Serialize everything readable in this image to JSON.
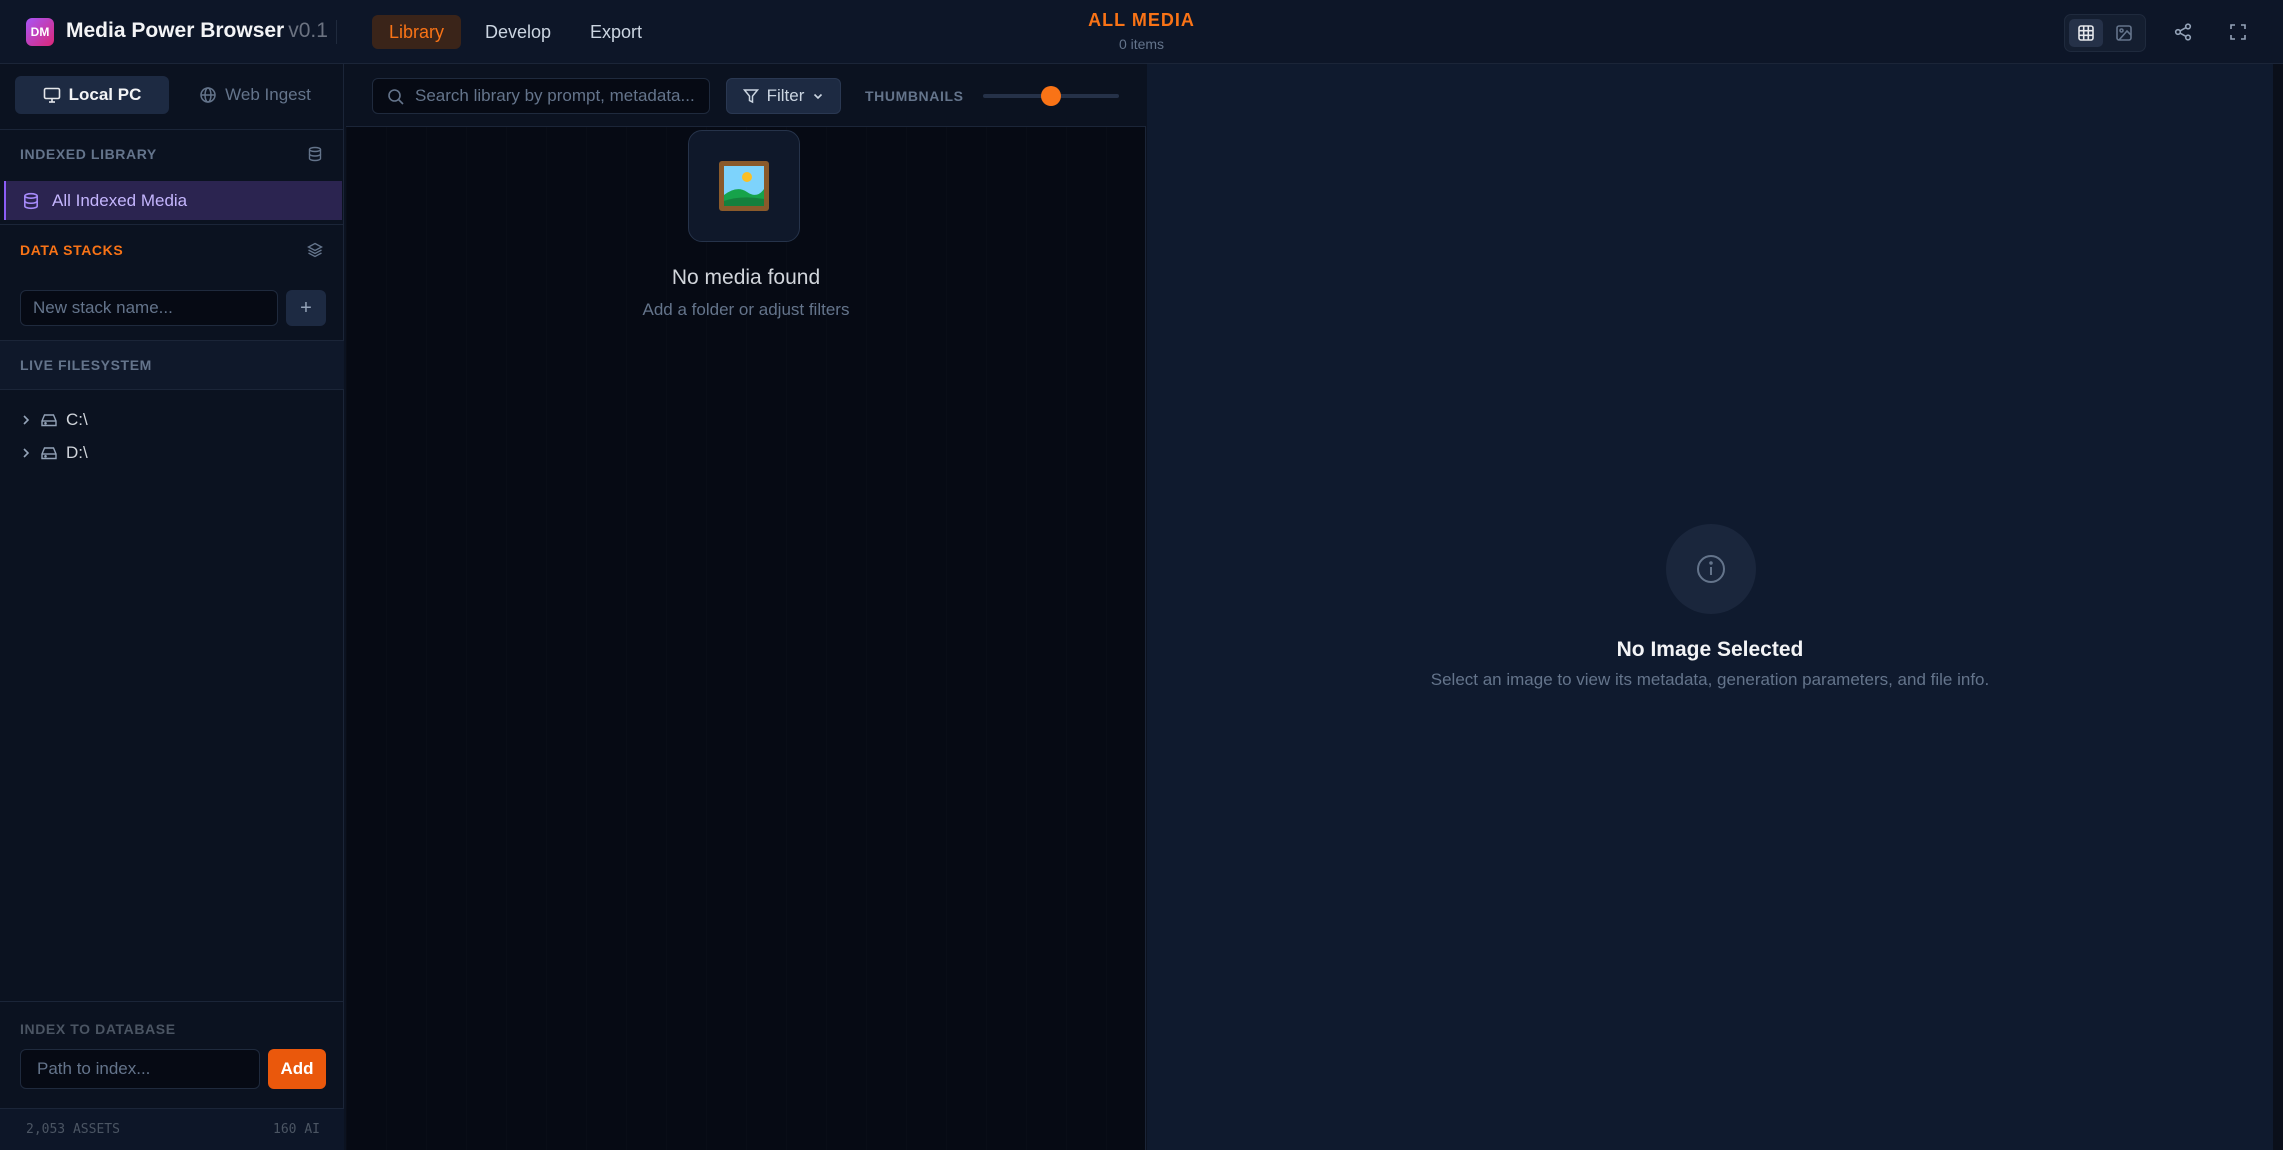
{
  "app": {
    "logo_text": "DM",
    "title": "Media Power Browser",
    "version": "v0.1"
  },
  "nav": {
    "tabs": [
      {
        "label": "Library",
        "active": true
      },
      {
        "label": "Develop",
        "active": false
      },
      {
        "label": "Export",
        "active": false
      }
    ]
  },
  "header": {
    "title": "ALL MEDIA",
    "subtitle": "0 items"
  },
  "view_toggle": {
    "options": [
      "grid-icon",
      "image-icon"
    ],
    "active": "grid-icon"
  },
  "top_actions": [
    "share-icon",
    "fullscreen-icon"
  ],
  "sidebar": {
    "source_tabs": [
      {
        "label": "Local PC",
        "icon": "monitor-icon",
        "active": true
      },
      {
        "label": "Web Ingest",
        "icon": "globe-icon",
        "active": false
      }
    ],
    "indexed_library": {
      "heading": "INDEXED LIBRARY",
      "items": [
        {
          "label": "All Indexed Media",
          "icon": "database-icon",
          "selected": true
        }
      ]
    },
    "data_stacks": {
      "heading": "DATA STACKS",
      "input_placeholder": "New stack name...",
      "add_label": "+"
    },
    "live_filesystem": {
      "heading": "LIVE FILESYSTEM",
      "drives": [
        {
          "label": "C:\\",
          "icon": "drive-icon",
          "expanded": false
        },
        {
          "label": "D:\\",
          "icon": "drive-icon",
          "expanded": false
        }
      ]
    },
    "index_to_db": {
      "heading": "INDEX TO DATABASE",
      "input_placeholder": "Path to index...",
      "add_label": "Add"
    },
    "footer": {
      "assets": "2,053 ASSETS",
      "ai_count": "160 AI"
    }
  },
  "toolbar": {
    "search_placeholder": "Search library by prompt, metadata...",
    "filter_label": "Filter",
    "thumbnails_label": "THUMBNAILS",
    "thumbnail_size": 0.5
  },
  "grid": {
    "empty_title": "No media found",
    "empty_subtitle": "Add a folder or adjust filters",
    "empty_icon": "framed-picture-icon"
  },
  "inspector": {
    "title": "No Image Selected",
    "subtitle": "Select an image to view its metadata, generation parameters, and file info.",
    "icon": "info-icon"
  },
  "colors": {
    "accent": "#f97316",
    "selection": "#8b5cf6",
    "background": "#0b1220"
  }
}
